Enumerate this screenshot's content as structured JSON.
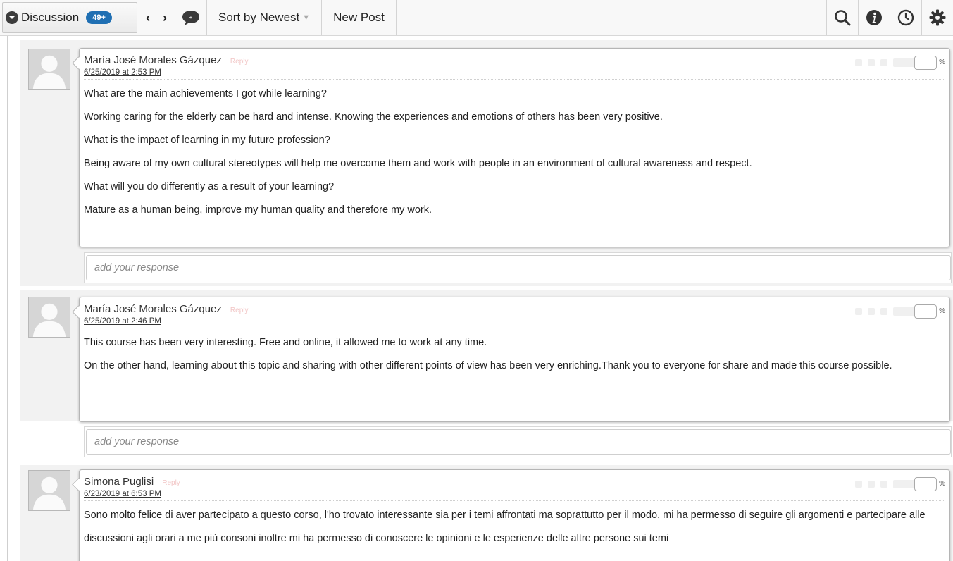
{
  "toolbar": {
    "discussion_label": "Discussion",
    "count_badge": "49+",
    "prev_arrow": "‹",
    "next_arrow": "›",
    "sort_label": "Sort by Newest",
    "new_post_label": "New Post",
    "icons": [
      "discussion-toggle-icon",
      "chat-bubble-icon",
      "search-icon",
      "info-icon",
      "clock-icon",
      "gear-icon"
    ]
  },
  "posts": [
    {
      "author": "María José Morales Gázquez",
      "reply_tag": "Reply",
      "timestamp": "6/25/2019 at 2:53 PM",
      "paragraphs": [
        "What are the main achievements I got while learning?",
        "Working caring for the elderly can be hard and intense. Knowing the experiences and emotions of others has been very positive.",
        "What is the impact of learning in my future profession?",
        "Being aware of my own cultural stereotypes will help me overcome them and work with people in an environment of cultural awareness and respect.",
        "What will you do differently as a result of your learning?",
        "Mature as a human being, improve my human quality and therefore my work."
      ],
      "percent_sign": "%",
      "response_placeholder": "add your response"
    },
    {
      "author": "María José Morales Gázquez",
      "reply_tag": "Reply",
      "timestamp": "6/25/2019 at 2:46 PM",
      "paragraphs": [
        "This course has been very interesting. Free and online, it allowed me to work at any time.",
        "On the other hand, learning about this topic and sharing with other different points of view has been very enriching.Thank you to everyone for share and made this course possible."
      ],
      "percent_sign": "%",
      "response_placeholder": "add your response"
    },
    {
      "author": "Simona Puglisi",
      "reply_tag": "Reply",
      "timestamp": "6/23/2019 at 6:53 PM",
      "paragraphs": [
        "Sono molto felice di aver partecipato a questo corso, l'ho trovato interessante sia per i temi affrontati ma soprattutto per il modo, mi ha permesso di seguire gli argomenti e partecipare alle discussioni agli orari a me più consoni inoltre mi ha permesso di conoscere le opinioni e le esperienze delle altre persone sui temi"
      ],
      "percent_sign": "%"
    }
  ],
  "colors": {
    "badge_blue": "#1f6fb3",
    "toolbar_bg": "#f8f8f8",
    "post_bg": "#f2f2f2"
  }
}
